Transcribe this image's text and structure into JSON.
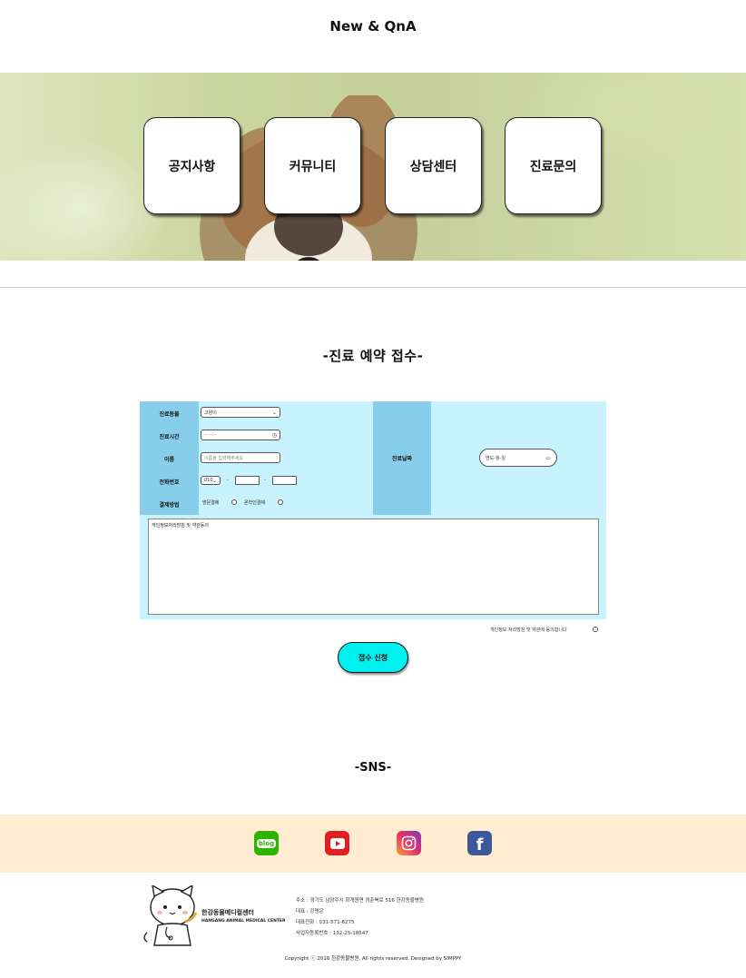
{
  "news": {
    "title": "New & QnA"
  },
  "menu": [
    {
      "label": "공지사항"
    },
    {
      "label": "커뮤니티"
    },
    {
      "label": "상담센터"
    },
    {
      "label": "진료문의"
    }
  ],
  "reservation": {
    "title": "-진료 예약 접수-",
    "rows": [
      {
        "label": "진료동물"
      },
      {
        "label": "진료시간"
      },
      {
        "label": "이름"
      },
      {
        "label": "전화번호"
      },
      {
        "label": "결제방법"
      }
    ],
    "animal_selected": "고양이",
    "time_placeholder": "-- --:--",
    "name_placeholder": "이름을 입력해주세요",
    "phone_prefix": "010",
    "phone_dash": "-",
    "payment_options": [
      "방문결제",
      "온라인결제"
    ],
    "date_label": "진료날짜",
    "date_placeholder": "연도-월-일",
    "terms_text": "개인정보처리방침 및 약관동의",
    "agree_text": "개인정보 처리방침 및 약관에 동의합니다",
    "submit_label": "접수 신청"
  },
  "sns": {
    "title": "-SNS-",
    "icons": [
      {
        "name": "blog-icon",
        "label": "blog",
        "color": "#2db400"
      },
      {
        "name": "youtube-icon",
        "color": "#e02020"
      },
      {
        "name": "instagram-icon",
        "color": "#c13584"
      },
      {
        "name": "facebook-icon",
        "color": "#3b5998"
      }
    ]
  },
  "footer": {
    "brand_ko": "한강동물메디컬센터",
    "brand_en": "HANGANG ANIMAL MEDICAL CENTER",
    "address": "주소 : 경기도 남양주시 화개원면 경춘북로 516 한강동물병원",
    "ceo": "대표 : 강명은",
    "phone": "대표전화 : 031-571-8275",
    "business_no": "사업자등록번호 : 132-25-18547",
    "copyright": "Copyright ⓒ 2016 한강동물병원. All rights reserved. Designed by SIMPPY"
  }
}
